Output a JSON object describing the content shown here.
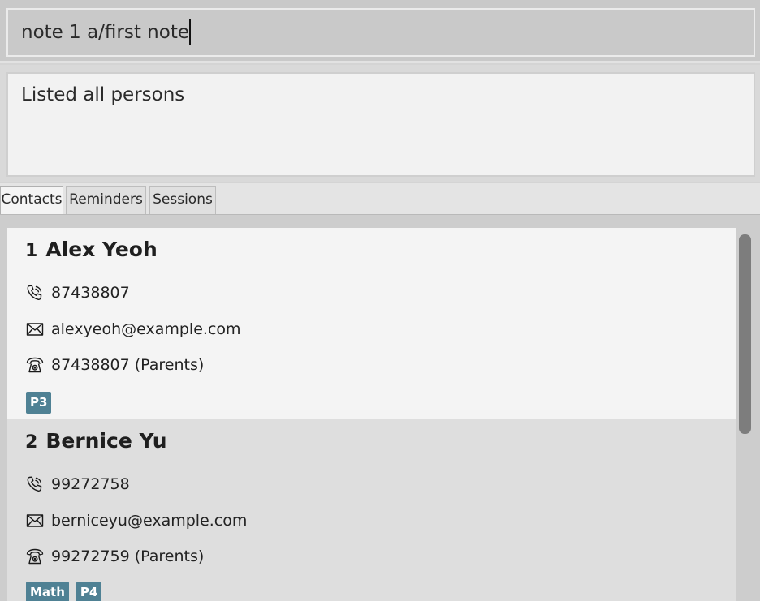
{
  "command": {
    "value": "note 1 a/first note"
  },
  "result": {
    "message": "Listed all persons"
  },
  "tabs": [
    {
      "label": "Contacts",
      "active": true
    },
    {
      "label": "Reminders",
      "active": false
    },
    {
      "label": "Sessions",
      "active": false
    }
  ],
  "persons": [
    {
      "index": "1",
      "name": "Alex Yeoh",
      "phone": "87438807",
      "email": "alexyeoh@example.com",
      "parent_phone": "87438807 (Parents)",
      "tags": [
        "P3"
      ]
    },
    {
      "index": "2",
      "name": "Bernice Yu",
      "phone": "99272758",
      "email": "berniceyu@example.com",
      "parent_phone": "99272759 (Parents)",
      "tags": [
        "Math",
        "P4"
      ]
    }
  ],
  "colors": {
    "tag_background": "#4f8194",
    "scroll_thumb": "#7d7d7d"
  },
  "icons": {
    "phone": "phone-icon",
    "email": "email-icon",
    "parent_phone": "telephone-icon"
  }
}
